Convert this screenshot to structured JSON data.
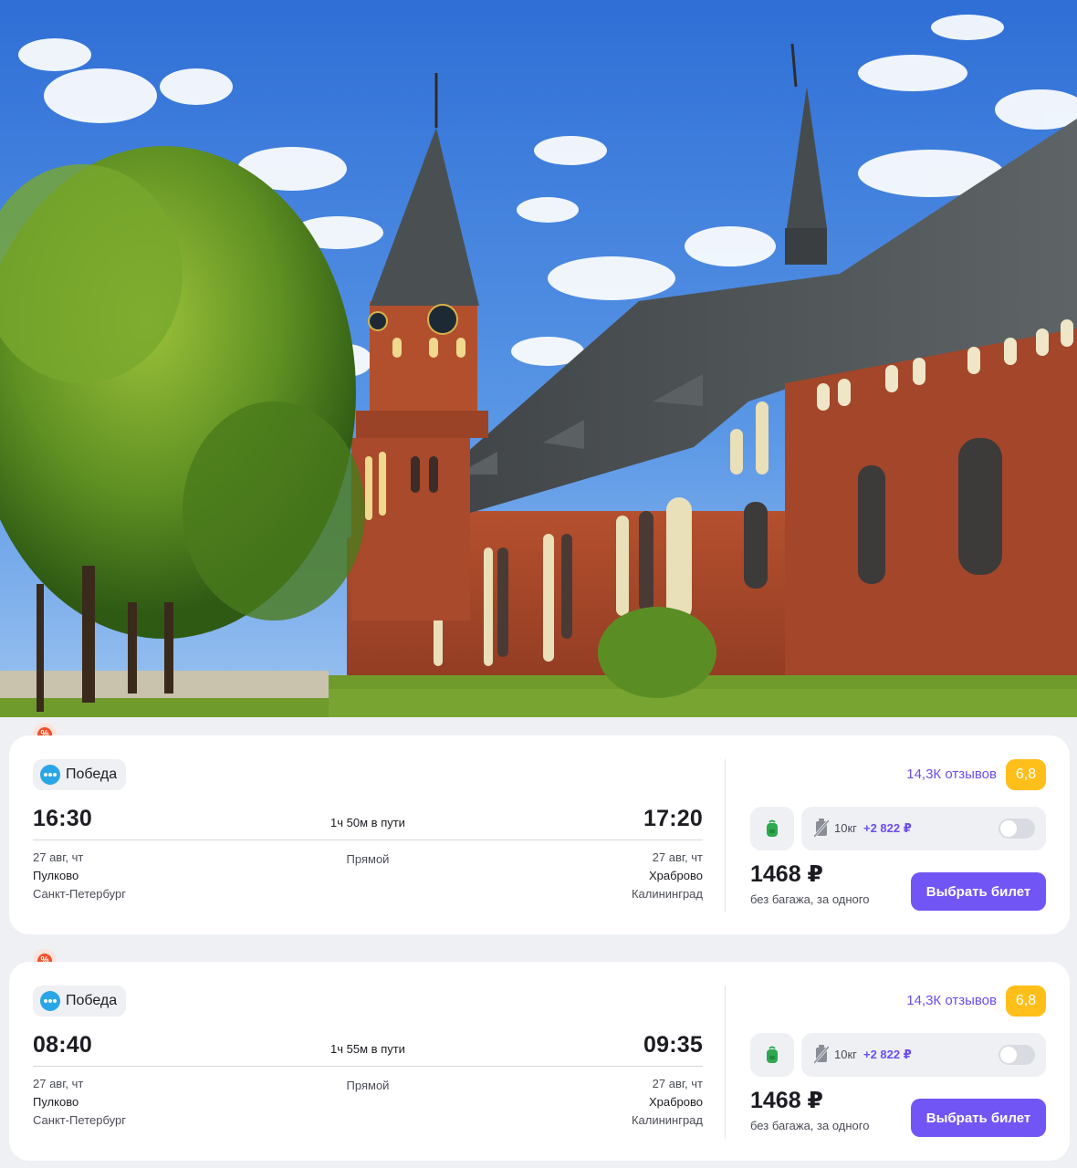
{
  "hero": {
    "icon": "cathedral-photo"
  },
  "colors": {
    "accent": "#7156f5",
    "rating": "#ffbf1a",
    "promo": "#f2502b",
    "airline_logo": "#2aa5e6"
  },
  "flights": [
    {
      "promo_icon": "percent-badge-icon",
      "airline": "Победа",
      "dep_time": "16:30",
      "arr_time": "17:20",
      "duration": "1ч 50м в пути",
      "transfer": "Прямой",
      "dep_date": "27 авг, чт",
      "dep_airport": "Пулково",
      "dep_city": "Санкт-Петербург",
      "arr_date": "27 авг, чт",
      "arr_airport": "Храброво",
      "arr_city": "Калининград",
      "reviews": "14,3К отзывов",
      "rating": "6,8",
      "baggage_weight": "10кг",
      "baggage_price": "+2 822 ₽",
      "baggage_toggle": "off",
      "price": "1468 ₽",
      "price_note": "без багажа, за одного",
      "button": "Выбрать билет"
    },
    {
      "promo_icon": "percent-badge-icon",
      "airline": "Победа",
      "dep_time": "08:40",
      "arr_time": "09:35",
      "duration": "1ч 55м в пути",
      "transfer": "Прямой",
      "dep_date": "27 авг, чт",
      "dep_airport": "Пулково",
      "dep_city": "Санкт-Петербург",
      "arr_date": "27 авг, чт",
      "arr_airport": "Храброво",
      "arr_city": "Калининград",
      "reviews": "14,3К отзывов",
      "rating": "6,8",
      "baggage_weight": "10кг",
      "baggage_price": "+2 822 ₽",
      "baggage_toggle": "off",
      "price": "1468 ₽",
      "price_note": "без багажа, за одного",
      "button": "Выбрать билет"
    }
  ]
}
